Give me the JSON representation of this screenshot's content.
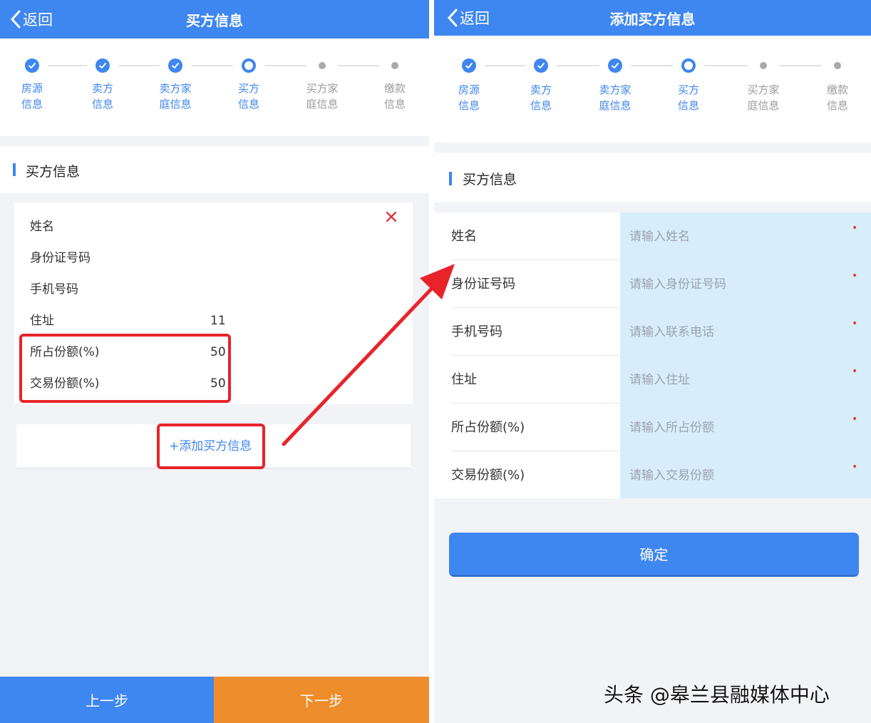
{
  "left": {
    "header": {
      "back_label": "返回",
      "title": "买方信息"
    },
    "steps": [
      {
        "label": "房源\n信息",
        "state": "done"
      },
      {
        "label": "卖方\n信息",
        "state": "done"
      },
      {
        "label": "卖方家\n庭信息",
        "state": "done"
      },
      {
        "label": "买方\n信息",
        "state": "current"
      },
      {
        "label": "买方家\n庭信息",
        "state": "todo"
      },
      {
        "label": "缴款\n信息",
        "state": "todo"
      }
    ],
    "section_title": "买方信息",
    "buyer": [
      {
        "label": "姓名",
        "value": ""
      },
      {
        "label": "身份证号码",
        "value": ""
      },
      {
        "label": "手机号码",
        "value": ""
      },
      {
        "label": "住址",
        "value": "11"
      },
      {
        "label": "所占份额(%)",
        "value": "50"
      },
      {
        "label": "交易份额(%)",
        "value": "50"
      }
    ],
    "close_glyph": "X",
    "add_label": "+添加买方信息",
    "prev_label": "上一步",
    "next_label": "下一步"
  },
  "right": {
    "header": {
      "back_label": "返回",
      "title": "添加买方信息"
    },
    "steps": [
      {
        "label": "房源\n信息",
        "state": "done"
      },
      {
        "label": "卖方\n信息",
        "state": "done"
      },
      {
        "label": "卖方家\n庭信息",
        "state": "done"
      },
      {
        "label": "买方\n信息",
        "state": "current"
      },
      {
        "label": "买方家\n庭信息",
        "state": "todo"
      },
      {
        "label": "缴款\n信息",
        "state": "todo"
      }
    ],
    "section_title": "买方信息",
    "fields": [
      {
        "label": "姓名",
        "placeholder": "请输入姓名",
        "required_mark": "•"
      },
      {
        "label": "身份证号码",
        "placeholder": "请输入身份证号码",
        "required_mark": "•"
      },
      {
        "label": "手机号码",
        "placeholder": "请输入联系电话",
        "required_mark": "•"
      },
      {
        "label": "住址",
        "placeholder": "请输入住址",
        "required_mark": "•"
      },
      {
        "label": "所占份额(%)",
        "placeholder": "请输入所占份额",
        "required_mark": "•"
      },
      {
        "label": "交易份额(%)",
        "placeholder": "请输入交易份额",
        "required_mark": "•"
      }
    ],
    "confirm_label": "确定"
  },
  "credit": "头条 @皋兰县融媒体中心",
  "colors": {
    "primary": "#3e86f0",
    "accent_orange": "#ee8d2c",
    "highlight_red": "#e8232a",
    "input_bg": "#d8edfa"
  }
}
